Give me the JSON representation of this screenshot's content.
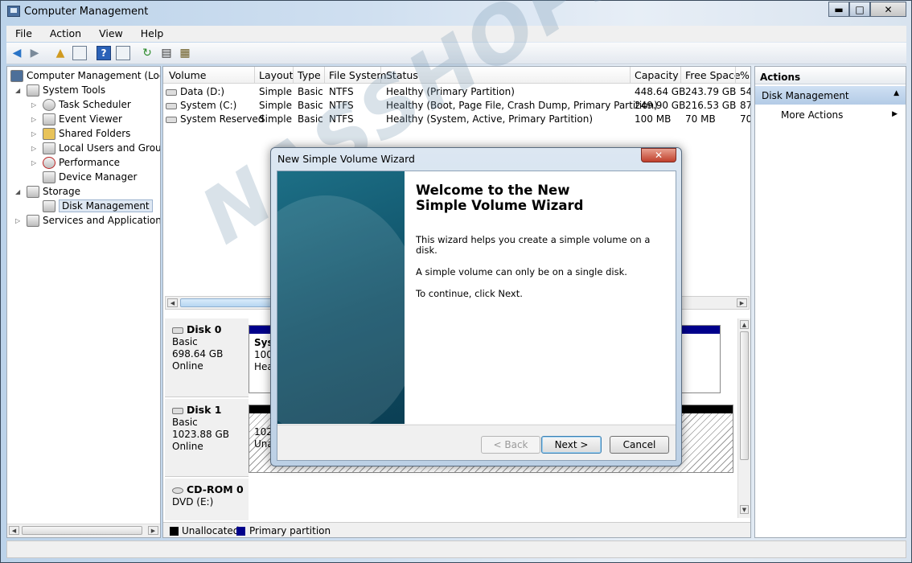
{
  "window": {
    "title": "Computer Management",
    "min_label": "▬",
    "max_label": "□",
    "close_label": "✕"
  },
  "menu": [
    "File",
    "Action",
    "View",
    "Help"
  ],
  "tree": {
    "root": "Computer Management (Local",
    "system_tools": "System Tools",
    "task_scheduler": "Task Scheduler",
    "event_viewer": "Event Viewer",
    "shared_folders": "Shared Folders",
    "local_users": "Local Users and Groups",
    "performance": "Performance",
    "device_manager": "Device Manager",
    "storage": "Storage",
    "disk_management": "Disk Management",
    "services": "Services and Applications"
  },
  "volume_headers": [
    "Volume",
    "Layout",
    "Type",
    "File System",
    "Status",
    "Capacity",
    "Free Space",
    "%"
  ],
  "volumes": [
    {
      "name": "Data (D:)",
      "layout": "Simple",
      "type": "Basic",
      "fs": "NTFS",
      "status": "Healthy (Primary Partition)",
      "capacity": "448.64 GB",
      "free": "243.79 GB",
      "pct": "54"
    },
    {
      "name": "System (C:)",
      "layout": "Simple",
      "type": "Basic",
      "fs": "NTFS",
      "status": "Healthy (Boot, Page File, Crash Dump, Primary Partition)",
      "capacity": "249.90 GB",
      "free": "216.53 GB",
      "pct": "87"
    },
    {
      "name": "System Reserved",
      "layout": "Simple",
      "type": "Basic",
      "fs": "NTFS",
      "status": "Healthy (System, Active, Primary Partition)",
      "capacity": "100 MB",
      "free": "70 MB",
      "pct": "70"
    }
  ],
  "disks": [
    {
      "name": "Disk 0",
      "type": "Basic",
      "size": "698.64 GB",
      "state": "Online",
      "part_frag1": "Syst",
      "part_frag2": "100",
      "part_frag3": "Hea"
    },
    {
      "name": "Disk 1",
      "type": "Basic",
      "size": "1023.88 GB",
      "state": "Online",
      "part_frag1": "1023",
      "part_frag2": "Una"
    },
    {
      "name": "CD-ROM 0",
      "type": "DVD (E:)"
    }
  ],
  "legend": {
    "unallocated": "Unallocated",
    "primary": "Primary partition",
    "unallocated_color": "#000000",
    "primary_color": "#00008b"
  },
  "actions": {
    "header": "Actions",
    "section": "Disk Management",
    "more": "More Actions"
  },
  "dialog": {
    "title": "New Simple Volume Wizard",
    "heading": "Welcome to the New Simple Volume Wizard",
    "p1": "This wizard helps you create a simple volume on a disk.",
    "p2": "A simple volume can only be on a single disk.",
    "p3": "To continue, click Next.",
    "back": "< Back",
    "next": "Next >",
    "cancel": "Cancel",
    "close": "✕"
  },
  "watermark": "NASSHOPS.net"
}
